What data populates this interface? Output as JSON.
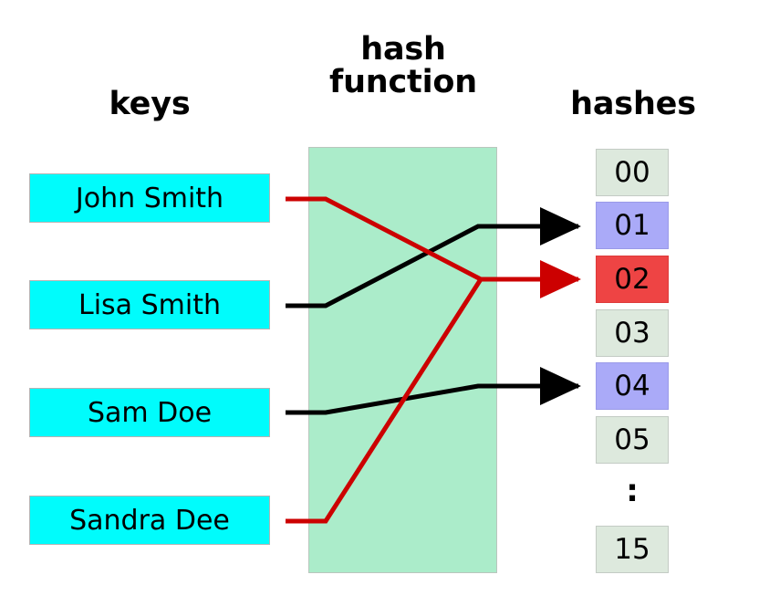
{
  "diagram": {
    "title": "hash table collision diagram",
    "columns": {
      "keys_heading": "keys",
      "function_heading": "hash\nfunction",
      "hashes_heading": "hashes"
    },
    "colors": {
      "key_box": "#00fcfc",
      "function_panel": "#abecca",
      "bucket_empty": "#dde9dd",
      "bucket_filled": "#aaaaf8",
      "bucket_collision": "#ee4444",
      "wire_normal": "#000000",
      "wire_collision": "#cc0000"
    },
    "keys": [
      {
        "label": "John Smith",
        "maps_to": "02",
        "wire_color": "collision"
      },
      {
        "label": "Lisa Smith",
        "maps_to": "01",
        "wire_color": "normal"
      },
      {
        "label": "Sam Doe",
        "maps_to": "04",
        "wire_color": "normal"
      },
      {
        "label": "Sandra Dee",
        "maps_to": "02",
        "wire_color": "collision"
      }
    ],
    "buckets": [
      {
        "label": "00",
        "state": "empty"
      },
      {
        "label": "01",
        "state": "filled"
      },
      {
        "label": "02",
        "state": "collision"
      },
      {
        "label": "03",
        "state": "empty"
      },
      {
        "label": "04",
        "state": "filled"
      },
      {
        "label": "05",
        "state": "empty"
      },
      {
        "label": "15",
        "state": "empty"
      }
    ],
    "ellipsis": ":"
  }
}
